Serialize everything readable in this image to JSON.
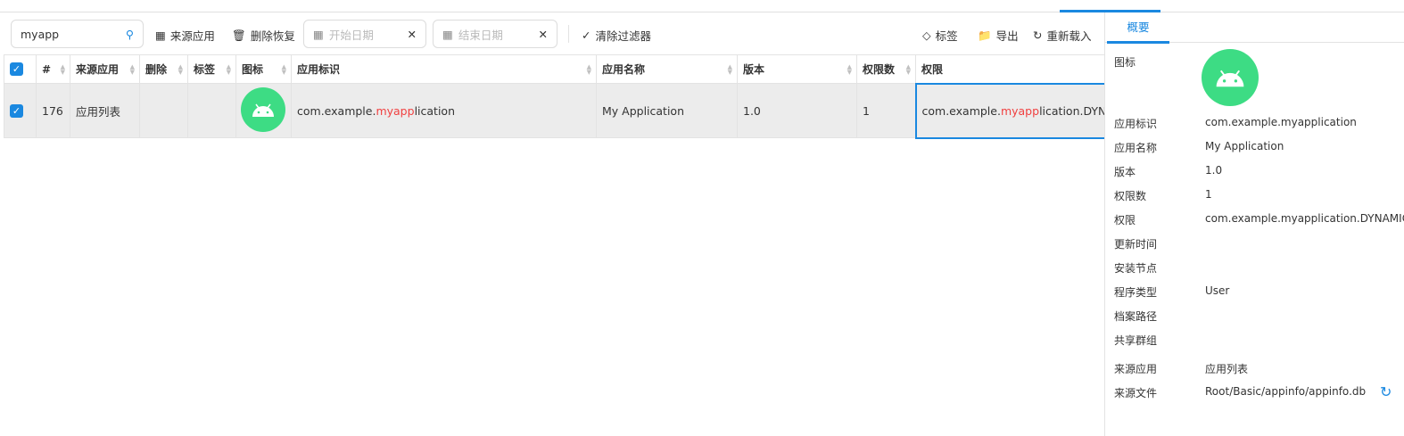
{
  "toolbar": {
    "search_value": "myapp",
    "source_app": "来源应用",
    "delete_restore": "删除恢复",
    "start_date_placeholder": "开始日期",
    "end_date_placeholder": "结束日期",
    "clear_filters": "清除过滤器",
    "tag": "标签",
    "export": "导出",
    "reload": "重新载入"
  },
  "table": {
    "columns": [
      "#",
      "来源应用",
      "删除",
      "标签",
      "图标",
      "应用标识",
      "应用名称",
      "版本",
      "权限数",
      "权限"
    ],
    "rows": [
      {
        "checked": true,
        "index": "176",
        "source_app": "应用列表",
        "deleted": "",
        "tag": "",
        "app_id_pre": "com.example.",
        "app_id_match": "myapp",
        "app_id_post": "lication",
        "app_name": "My Application",
        "version": "1.0",
        "perm_count": "1",
        "perm_pre": "com.example.",
        "perm_match": "myapp",
        "perm_post": "lication.DYNAMIC_RECEIVER_NOT_EXPORTED_PERMISSION"
      }
    ]
  },
  "panel": {
    "tab": "概要",
    "fields": [
      {
        "k": "图标",
        "v": ""
      },
      {
        "k": "应用标识",
        "v": "com.example.myapplication"
      },
      {
        "k": "应用名称",
        "v": "My Application"
      },
      {
        "k": "版本",
        "v": "1.0"
      },
      {
        "k": "权限数",
        "v": "1"
      },
      {
        "k": "权限",
        "v": "com.example.myapplication.DYNAMIC_RECEIVER_NOT_EXPORTED_PERMISSION"
      },
      {
        "k": "更新时间",
        "v": ""
      },
      {
        "k": "安装节点",
        "v": ""
      },
      {
        "k": "程序类型",
        "v": "User"
      },
      {
        "k": "档案路径",
        "v": ""
      },
      {
        "k": "共享群组",
        "v": ""
      },
      {
        "k": "来源应用",
        "v": "应用列表"
      },
      {
        "k": "来源文件",
        "v": "Root/Basic/appinfo/appinfo.db"
      }
    ]
  },
  "colors": {
    "accent": "#1a88e0",
    "highlight": "#f04040",
    "android_green": "#3ddc84"
  }
}
